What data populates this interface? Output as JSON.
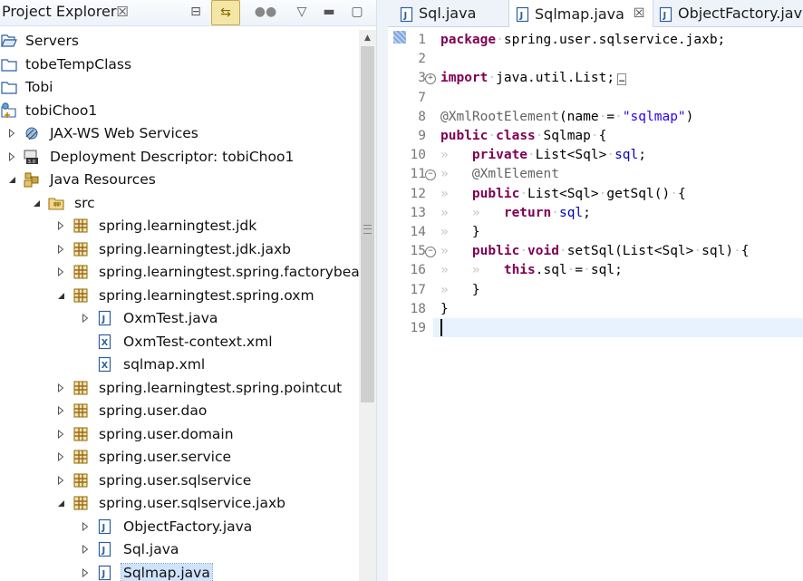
{
  "project_explorer": {
    "title": "Project Explorer",
    "close": "☒",
    "toolbar": {
      "collapse_all": "⊟",
      "link_editor": "⇆",
      "filter": "●●",
      "view_menu": "▽",
      "minimize": "▬",
      "maximize": "▢"
    },
    "tree": [
      {
        "label": "Servers",
        "icon": "folder-open-icon",
        "twisty": "none",
        "indent": 0
      },
      {
        "label": "tobeTempClass",
        "icon": "folder-icon",
        "twisty": "none",
        "indent": 0
      },
      {
        "label": "Tobi",
        "icon": "folder-icon",
        "twisty": "none",
        "indent": 0
      },
      {
        "label": "tobiChoo1",
        "icon": "web-project-icon",
        "twisty": "none",
        "indent": 0
      },
      {
        "label": "JAX-WS Web Services",
        "icon": "web-services-icon",
        "twisty": "collapsed",
        "indent": 1
      },
      {
        "label": "Deployment Descriptor: tobiChoo1",
        "icon": "deployment-descriptor-icon",
        "twisty": "collapsed",
        "indent": 1
      },
      {
        "label": "Java Resources",
        "icon": "java-resources-icon",
        "twisty": "expanded",
        "indent": 1
      },
      {
        "label": "src",
        "icon": "source-folder-icon",
        "twisty": "expanded",
        "indent": 2
      },
      {
        "label": "spring.learningtest.jdk",
        "icon": "package-icon",
        "twisty": "collapsed",
        "indent": 3
      },
      {
        "label": "spring.learningtest.jdk.jaxb",
        "icon": "package-icon",
        "twisty": "collapsed",
        "indent": 3
      },
      {
        "label": "spring.learningtest.spring.factorybean",
        "icon": "package-icon",
        "twisty": "collapsed",
        "indent": 3
      },
      {
        "label": "spring.learningtest.spring.oxm",
        "icon": "package-icon",
        "twisty": "expanded",
        "indent": 3
      },
      {
        "label": "OxmTest.java",
        "icon": "java-file-icon",
        "twisty": "collapsed",
        "indent": 4
      },
      {
        "label": "OxmTest-context.xml",
        "icon": "xml-file-icon",
        "twisty": "none",
        "indent": 4
      },
      {
        "label": "sqlmap.xml",
        "icon": "xml-file-icon",
        "twisty": "none",
        "indent": 4
      },
      {
        "label": "spring.learningtest.spring.pointcut",
        "icon": "package-icon",
        "twisty": "collapsed",
        "indent": 3
      },
      {
        "label": "spring.user.dao",
        "icon": "package-icon",
        "twisty": "collapsed",
        "indent": 3
      },
      {
        "label": "spring.user.domain",
        "icon": "package-icon",
        "twisty": "collapsed",
        "indent": 3
      },
      {
        "label": "spring.user.service",
        "icon": "package-icon",
        "twisty": "collapsed",
        "indent": 3
      },
      {
        "label": "spring.user.sqlservice",
        "icon": "package-icon",
        "twisty": "collapsed",
        "indent": 3
      },
      {
        "label": "spring.user.sqlservice.jaxb",
        "icon": "package-icon",
        "twisty": "expanded",
        "indent": 3
      },
      {
        "label": "ObjectFactory.java",
        "icon": "java-file-icon",
        "twisty": "collapsed",
        "indent": 4
      },
      {
        "label": "Sql.java",
        "icon": "java-file-icon",
        "twisty": "collapsed",
        "indent": 4
      },
      {
        "label": "Sqlmap.java",
        "icon": "java-file-icon",
        "twisty": "collapsed",
        "indent": 4,
        "selected": true
      }
    ]
  },
  "editor": {
    "tabs": [
      {
        "label": "Sql.java",
        "active": false
      },
      {
        "label": "Sqlmap.java",
        "active": true,
        "close": "☒"
      },
      {
        "label": "ObjectFactory.jav",
        "active": false
      }
    ],
    "lines": [
      {
        "n": "1",
        "fold": "",
        "segs": [
          [
            "kw",
            "package"
          ],
          [
            "ws",
            "·"
          ],
          [
            "",
            "spring.user.sqlservice.jaxb;"
          ]
        ]
      },
      {
        "n": "2",
        "fold": "",
        "segs": []
      },
      {
        "n": "3",
        "fold": "plus",
        "segs": [
          [
            "kw",
            "import"
          ],
          [
            "ws",
            "·"
          ],
          [
            "",
            "java.util.List;"
          ],
          [
            "box",
            "…"
          ]
        ]
      },
      {
        "n": "7",
        "fold": "",
        "segs": []
      },
      {
        "n": "8",
        "fold": "",
        "segs": [
          [
            "ann",
            "@XmlRootElement"
          ],
          [
            "",
            "(name"
          ],
          [
            "ws",
            "·"
          ],
          [
            "",
            "="
          ],
          [
            "ws",
            "·"
          ],
          [
            "str",
            "\"sqlmap\""
          ],
          [
            "",
            ")"
          ]
        ]
      },
      {
        "n": "9",
        "fold": "",
        "segs": [
          [
            "kw",
            "public"
          ],
          [
            "ws",
            "·"
          ],
          [
            "kw",
            "class"
          ],
          [
            "ws",
            "·"
          ],
          [
            "",
            "Sqlmap"
          ],
          [
            "ws",
            "·"
          ],
          [
            "",
            "{"
          ]
        ]
      },
      {
        "n": "10",
        "fold": "",
        "segs": [
          [
            "ws",
            "»   "
          ],
          [
            "kw",
            "private"
          ],
          [
            "ws",
            "·"
          ],
          [
            "",
            "List<Sql>"
          ],
          [
            "ws",
            "·"
          ],
          [
            "fld",
            "sql"
          ],
          [
            "",
            ";"
          ]
        ]
      },
      {
        "n": "11",
        "fold": "minus",
        "segs": [
          [
            "ws",
            "»   "
          ],
          [
            "ann",
            "@XmlElement"
          ]
        ]
      },
      {
        "n": "12",
        "fold": "",
        "segs": [
          [
            "ws",
            "»   "
          ],
          [
            "kw",
            "public"
          ],
          [
            "ws",
            "·"
          ],
          [
            "",
            "List<Sql>"
          ],
          [
            "ws",
            "·"
          ],
          [
            "",
            "getSql()"
          ],
          [
            "ws",
            "·"
          ],
          [
            "",
            "{"
          ]
        ]
      },
      {
        "n": "13",
        "fold": "",
        "segs": [
          [
            "ws",
            "»   »   "
          ],
          [
            "kw",
            "return"
          ],
          [
            "ws",
            "·"
          ],
          [
            "fld",
            "sql"
          ],
          [
            "",
            ";"
          ]
        ]
      },
      {
        "n": "14",
        "fold": "",
        "segs": [
          [
            "ws",
            "»   "
          ],
          [
            "",
            "}"
          ]
        ]
      },
      {
        "n": "15",
        "fold": "minus",
        "segs": [
          [
            "ws",
            "»   "
          ],
          [
            "kw",
            "public"
          ],
          [
            "ws",
            "·"
          ],
          [
            "kw",
            "void"
          ],
          [
            "ws",
            "·"
          ],
          [
            "",
            "setSql(List<Sql>"
          ],
          [
            "ws",
            "·"
          ],
          [
            "",
            "sql)"
          ],
          [
            "ws",
            "·"
          ],
          [
            "",
            "{"
          ]
        ]
      },
      {
        "n": "16",
        "fold": "",
        "segs": [
          [
            "ws",
            "»   »   "
          ],
          [
            "kw",
            "this"
          ],
          [
            "",
            ".sql"
          ],
          [
            "ws",
            "·"
          ],
          [
            "",
            "="
          ],
          [
            "ws",
            "·"
          ],
          [
            "",
            "sql;"
          ]
        ]
      },
      {
        "n": "17",
        "fold": "",
        "segs": [
          [
            "ws",
            "»   "
          ],
          [
            "",
            "}"
          ]
        ]
      },
      {
        "n": "18",
        "fold": "",
        "segs": [
          [
            "",
            "}"
          ]
        ]
      },
      {
        "n": "19",
        "fold": "",
        "segs": []
      }
    ]
  },
  "colors": {
    "keyword": "#7f0055",
    "annotation": "#646464",
    "string": "#2a00ff",
    "field": "#0000c0",
    "current_line": "#e8f2fe",
    "selection": "#cfe3fb"
  }
}
